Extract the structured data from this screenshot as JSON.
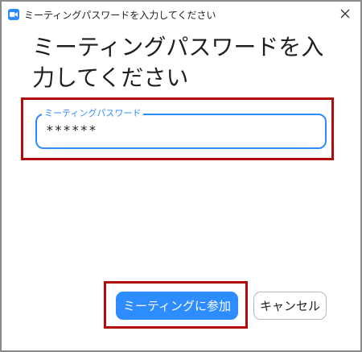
{
  "window": {
    "title": "ミーティングパスワードを入力してください",
    "close_icon": "close-icon",
    "app_icon": "zoom-camera-icon",
    "accent": "#2d8cff",
    "highlight": "#b00d0d"
  },
  "dialog": {
    "heading": "ミーティングパスワードを入力してください",
    "password_label": "ミーティングパスワード",
    "password_value": "******"
  },
  "buttons": {
    "join_label": "ミーティングに参加",
    "cancel_label": "キャンセル"
  }
}
